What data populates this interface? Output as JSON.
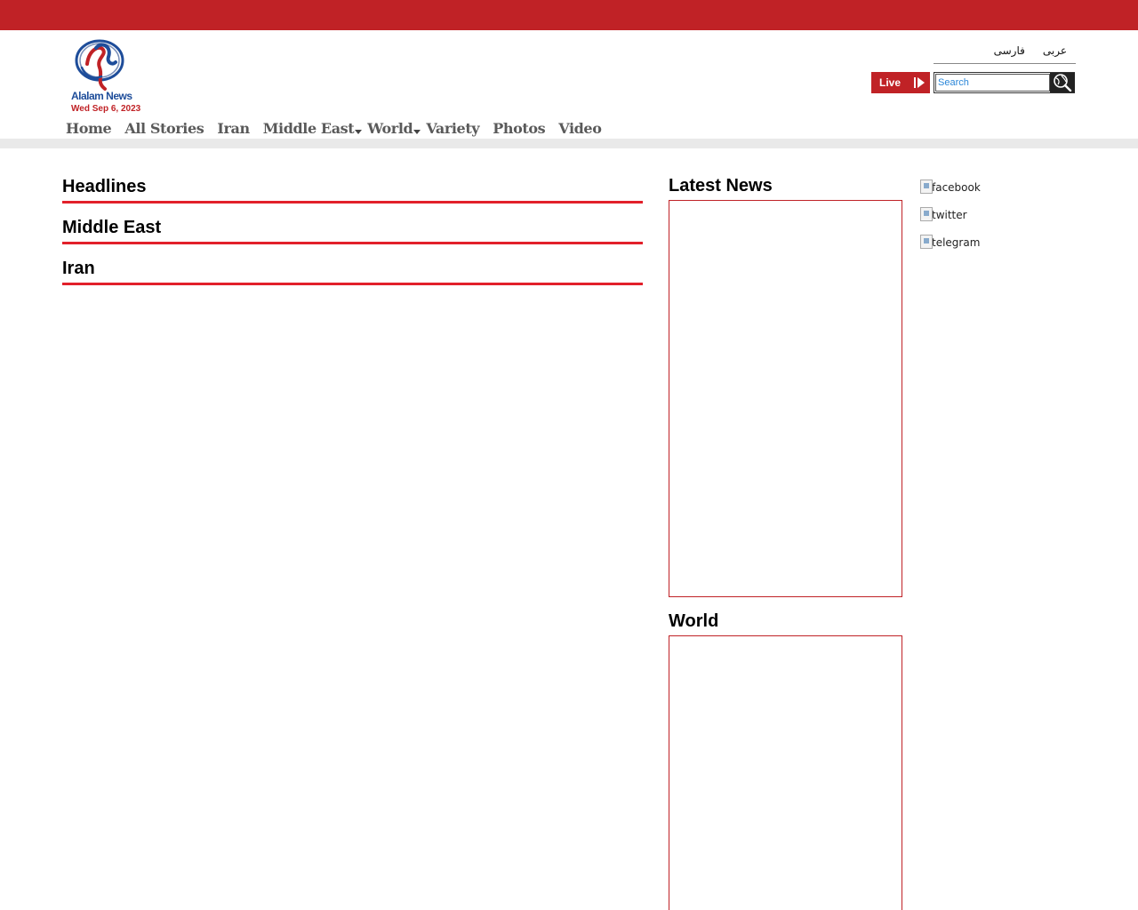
{
  "header": {
    "logo_name": "Alalam News",
    "date": "Wed Sep 6, 2023",
    "languages": [
      "عربی",
      "فارسی"
    ],
    "live_label": "Live",
    "search": {
      "placeholder": "Search",
      "value": ""
    }
  },
  "nav": {
    "items": [
      {
        "label": "Home",
        "has_dropdown": false
      },
      {
        "label": "All Stories",
        "has_dropdown": false
      },
      {
        "label": "Iran",
        "has_dropdown": false
      },
      {
        "label": "Middle East",
        "has_dropdown": true
      },
      {
        "label": "World",
        "has_dropdown": true
      },
      {
        "label": "Variety",
        "has_dropdown": false
      },
      {
        "label": "Photos",
        "has_dropdown": false
      },
      {
        "label": "Video",
        "has_dropdown": false
      }
    ]
  },
  "main": {
    "sections": [
      "Headlines",
      "Middle East",
      "Iran"
    ]
  },
  "sidebar": {
    "latest_title": "Latest News",
    "world_title": "World"
  },
  "social": [
    "facebook",
    "twitter",
    "telegram"
  ],
  "colors": {
    "brand_red": "#c02226",
    "rule_red": "#e2202a",
    "logo_blue": "#1e4d9a"
  }
}
